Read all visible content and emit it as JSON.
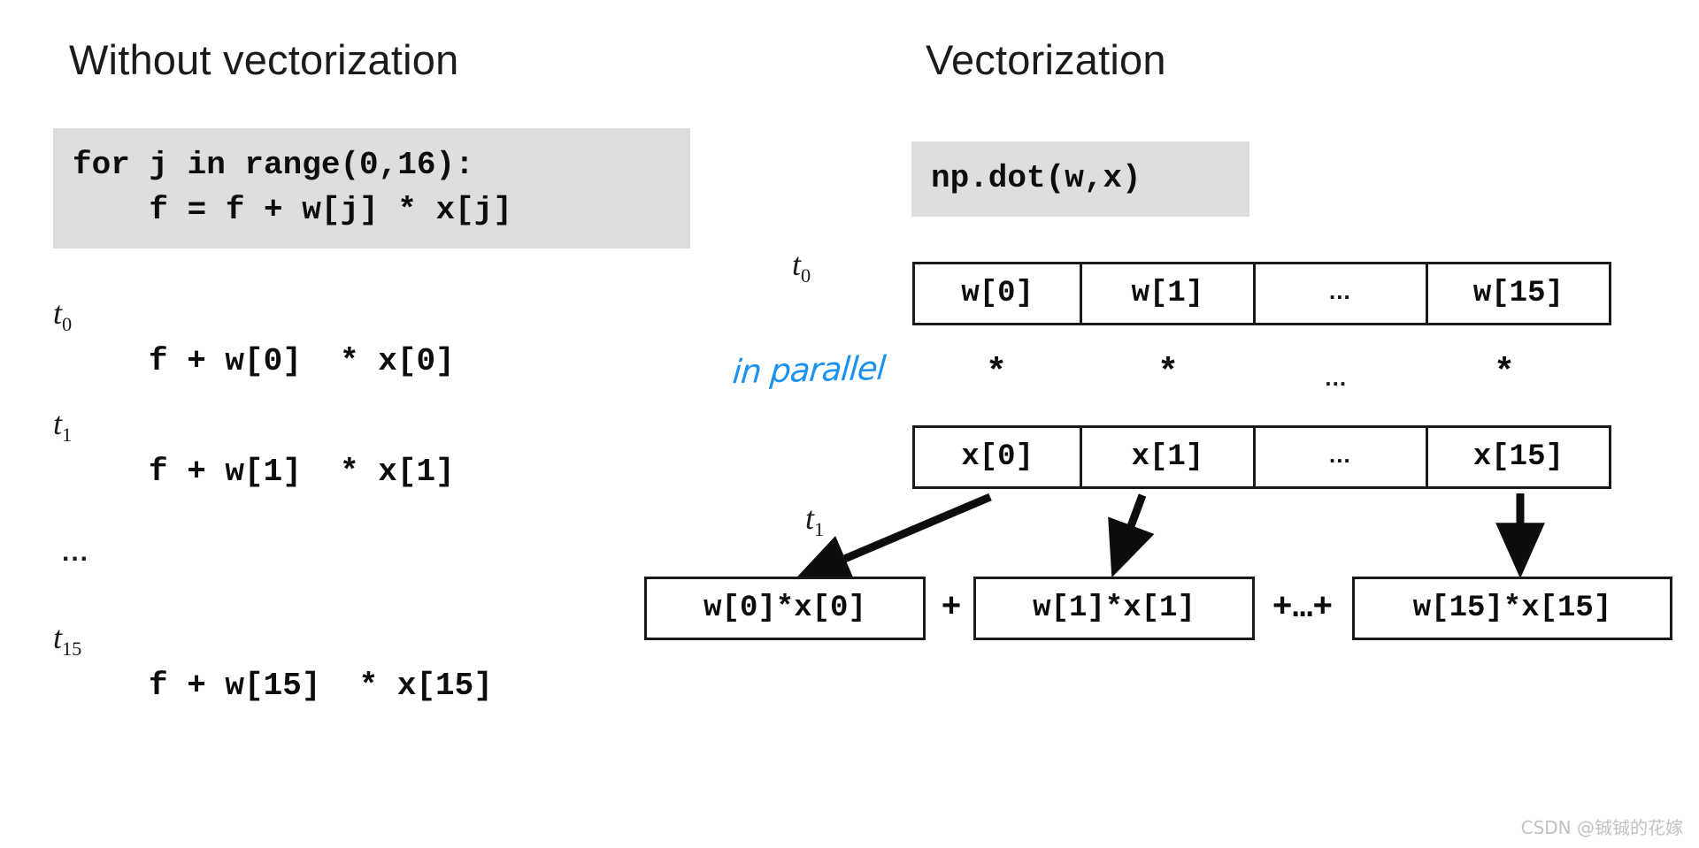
{
  "slide": {
    "background": "#ffffff",
    "accent_handwriting": "#1b91f0",
    "code_background": "#dedede"
  },
  "left_panel": {
    "heading": "Without vectorization",
    "code": "for j in range(0,16):\n    f = f + w[j] * x[j]",
    "steps": [
      {
        "time": "t",
        "sub": "0",
        "expr": "f + w[0]  * x[0]"
      },
      {
        "time": "t",
        "sub": "1",
        "expr": "f + w[1]  * x[1]"
      },
      {
        "time": "t",
        "sub": "15",
        "expr": "f + w[15]  * x[15]"
      }
    ],
    "ellipsis": "..."
  },
  "right_panel": {
    "heading": "Vectorization",
    "code": "np.dot(w,x)",
    "time_label_top": {
      "time": "t",
      "sub": "0"
    },
    "time_label_bottom": {
      "time": "t",
      "sub": "1"
    },
    "annotation": "in parallel",
    "w_array": {
      "name": "w",
      "cells": [
        "w[0]",
        "w[1]",
        "…",
        "w[15]"
      ]
    },
    "x_array": {
      "name": "x",
      "cells": [
        "x[0]",
        "x[1]",
        "…",
        "x[15]"
      ]
    },
    "operators": {
      "star": "*",
      "star_dots": "…"
    },
    "result": {
      "boxes": [
        "w[0]*x[0]",
        "w[1]*x[1]",
        "w[15]*x[15]"
      ],
      "separators": [
        "+",
        "+…+"
      ]
    }
  },
  "watermark": "CSDN @铖铖的花嫁"
}
